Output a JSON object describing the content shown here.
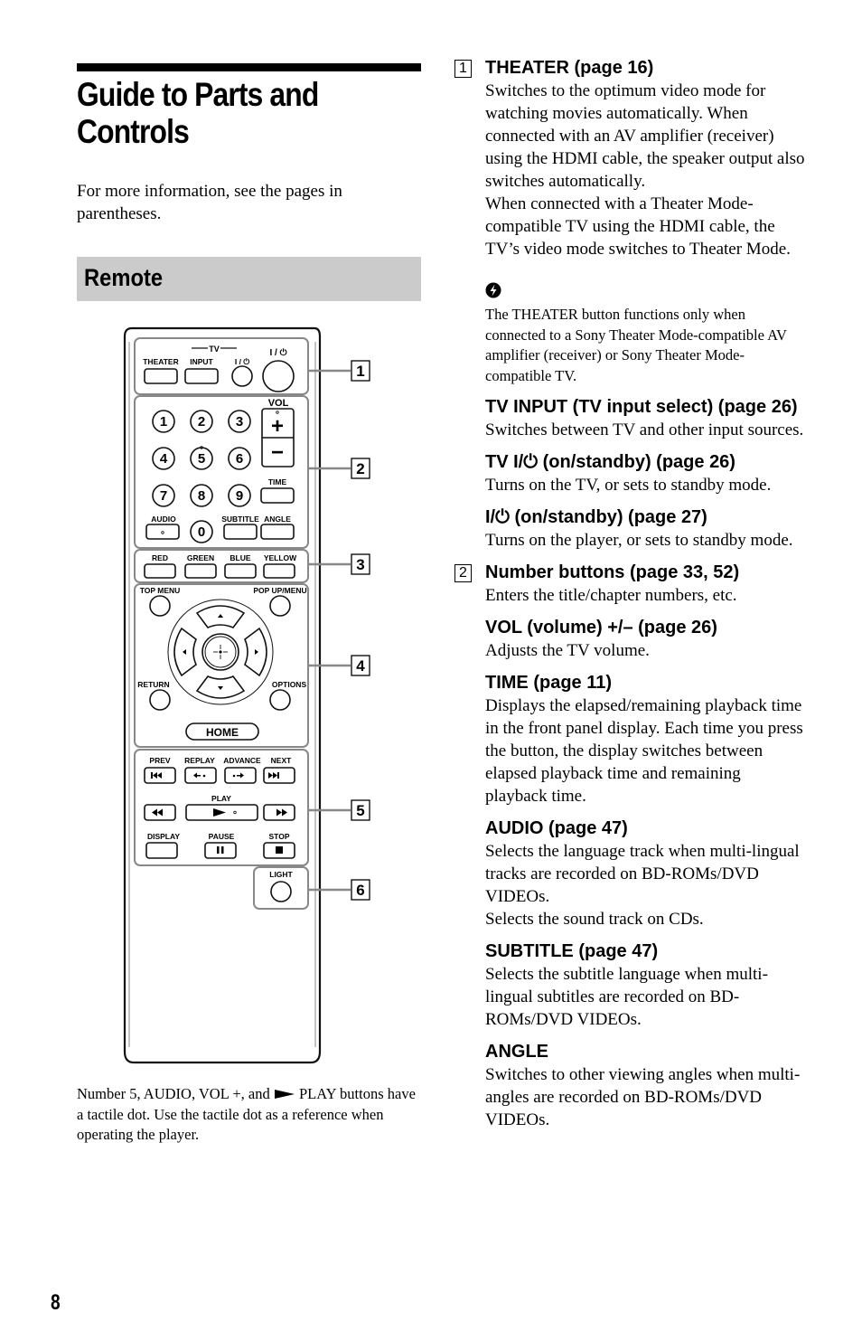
{
  "page": {
    "title_line1": "Guide to Parts and",
    "title_line2": "Controls",
    "intro": "For more information, see the pages in parentheses.",
    "section": "Remote",
    "caption_pre": "Number 5, AUDIO, VOL +, and",
    "caption_post": "PLAY buttons have a tactile dot. Use the tactile dot as a reference when operating the player.",
    "page_number": "8"
  },
  "remote": {
    "callouts": [
      "1",
      "2",
      "3",
      "4",
      "5",
      "6"
    ],
    "labels": {
      "tv_group": "TV",
      "theater": "THEATER",
      "input": "INPUT",
      "tv_power": "I / ⏻",
      "power": "I / ⏻",
      "vol": "VOL",
      "plus": "+",
      "minus": "−",
      "n1": "1",
      "n2": "2",
      "n3": "3",
      "n4": "4",
      "n5": "5",
      "n6": "6",
      "n7": "7",
      "n8": "8",
      "n9": "9",
      "n0": "0",
      "time": "TIME",
      "audio": "AUDIO",
      "subtitle": "SUBTITLE",
      "angle": "ANGLE",
      "red": "RED",
      "green": "GREEN",
      "blue": "BLUE",
      "yellow": "YELLOW",
      "top_menu": "TOP MENU",
      "popup_menu": "POP UP/MENU",
      "return": "RETURN",
      "options": "OPTIONS",
      "home": "HOME",
      "prev": "PREV",
      "replay": "REPLAY",
      "advance": "ADVANCE",
      "next": "NEXT",
      "play": "PLAY",
      "display": "DISPLAY",
      "pause": "PAUSE",
      "stop": "STOP",
      "light": "LIGHT"
    }
  },
  "entries": [
    {
      "num": "1",
      "heading": "THEATER (page 16)",
      "body": [
        "Switches to the optimum video mode for watching movies automatically. When connected with an AV amplifier (receiver) using the HDMI cable, the speaker output also switches automatically.",
        "When connected with a Theater Mode-compatible TV using the HDMI cable, the TV’s video mode switches to Theater Mode."
      ]
    },
    {
      "note": "The THEATER button functions only when connected to a Sony Theater Mode-compatible AV amplifier (receiver) or Sony Theater Mode-compatible TV."
    },
    {
      "heading": "TV INPUT (TV input select) (page 26)",
      "body": [
        "Switches between TV and other input sources."
      ]
    },
    {
      "heading_pre": "TV ",
      "heading_power": "I/⏻",
      "heading_post": " (on/standby) (page 26)",
      "body": [
        "Turns on the TV, or sets to standby mode."
      ]
    },
    {
      "heading_power": "I/⏻",
      "heading_post": " (on/standby) (page 27)",
      "body": [
        "Turns on the player, or sets to standby mode."
      ]
    },
    {
      "num": "2",
      "heading": "Number buttons (page 33, 52)",
      "body": [
        "Enters the title/chapter numbers, etc."
      ]
    },
    {
      "heading": "VOL (volume) +/– (page 26)",
      "body": [
        "Adjusts the TV volume."
      ]
    },
    {
      "heading": "TIME (page 11)",
      "body": [
        "Displays the elapsed/remaining playback time in the front panel display. Each time you press the button, the display switches between elapsed playback time and remaining playback time."
      ]
    },
    {
      "heading": "AUDIO (page 47)",
      "body": [
        "Selects the language track when multi-lingual tracks are recorded on BD-ROMs/DVD VIDEOs.",
        "Selects the sound track on CDs."
      ]
    },
    {
      "heading": "SUBTITLE (page 47)",
      "body": [
        "Selects the subtitle language when multi-lingual subtitles are recorded on BD-ROMs/DVD VIDEOs."
      ]
    },
    {
      "heading": "ANGLE",
      "body": [
        "Switches to other viewing angles when multi-angles are recorded on BD-ROMs/DVD VIDEOs."
      ]
    }
  ]
}
